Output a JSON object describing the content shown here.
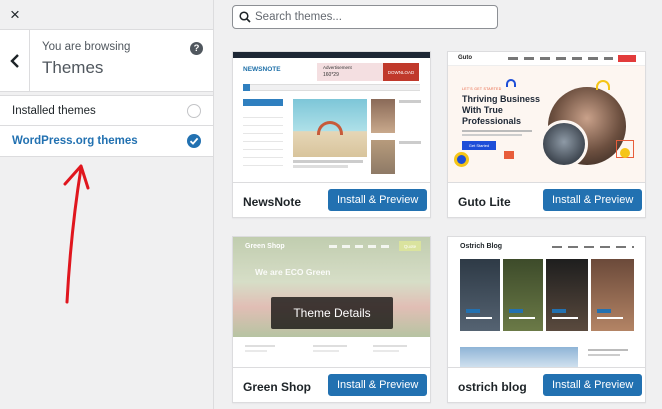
{
  "sidebar": {
    "close_label": "×",
    "back_label": "‹",
    "browsing_label": "You are browsing",
    "browsing_title": "Themes",
    "help_label": "?",
    "items": [
      {
        "label": "Installed themes",
        "active": false
      },
      {
        "label": "WordPress.org themes",
        "active": true
      }
    ]
  },
  "search": {
    "placeholder": "Search themes..."
  },
  "themes": [
    {
      "name": "NewsNote",
      "button": "Install & Preview",
      "preview": {
        "logo": "NEWSNOTE",
        "ad_line1": "Advertisement",
        "ad_line2": "160*29",
        "ad_button": "DOWNLOAD"
      }
    },
    {
      "name": "Guto Lite",
      "button": "Install & Preview",
      "preview": {
        "logo": "Guto",
        "kicker": "LET'S GET STARTED",
        "headline_1": "Thriving Business",
        "headline_2": "With True",
        "headline_3": "Professionals",
        "cta": "Get Started"
      }
    },
    {
      "name": "Green Shop",
      "button": "Install & Preview",
      "details_label": "Theme Details",
      "preview": {
        "logo": "Green Shop",
        "headline": "We are ECO Green",
        "nav_button": "Quote"
      }
    },
    {
      "name": "ostrich blog",
      "button": "Install & Preview",
      "preview": {
        "logo": "Ostrich Blog"
      }
    }
  ],
  "colors": {
    "accent": "#2271b1",
    "annotation": "#e0161e"
  }
}
